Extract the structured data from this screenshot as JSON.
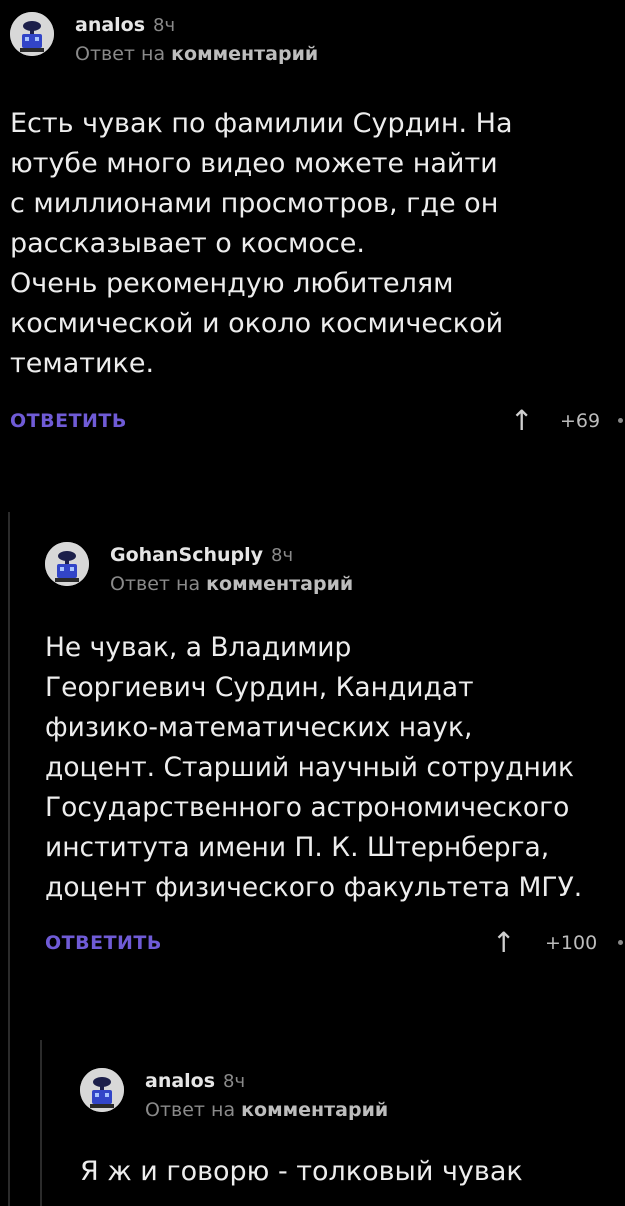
{
  "comments": [
    {
      "author": "analos",
      "time": "8ч",
      "reply_prefix": "Ответ на",
      "reply_link": "комментарий",
      "text": "Есть чувак по фамилии Сурдин. На\nютубе много видео можете найти\nс миллионами просмотров, где он\nрассказывает о космосе.\nОчень рекомендую любителям\nкосмической и около космической\nтематике.",
      "reply_label": "ОТВЕТИТЬ",
      "rating": "+69"
    },
    {
      "author": "GohanSchuply",
      "time": "8ч",
      "reply_prefix": "Ответ на",
      "reply_link": "комментарий",
      "text": "Не чувак, а Владимир\nГеоргиевич Сурдин, Кандидат\nфизико-математических наук,\nдоцент. Старший научный сотрудник\nГосударственного астрономического\nинститута имени П. К. Штернберга,\nдоцент физического факультета МГУ.",
      "reply_label": "ОТВЕТИТЬ",
      "rating": "+100"
    },
    {
      "author": "analos",
      "time": "8ч",
      "reply_prefix": "Ответ на",
      "reply_link": "комментарий",
      "text": "Я ж и говорю - толковый чувак"
    }
  ],
  "colors": {
    "background": "#000000",
    "reply_button": "#6f5bd6",
    "muted_text": "#8a8a8a"
  },
  "icons": {
    "avatar": "avatar-icon",
    "upvote": "upvote-arrow-icon"
  }
}
